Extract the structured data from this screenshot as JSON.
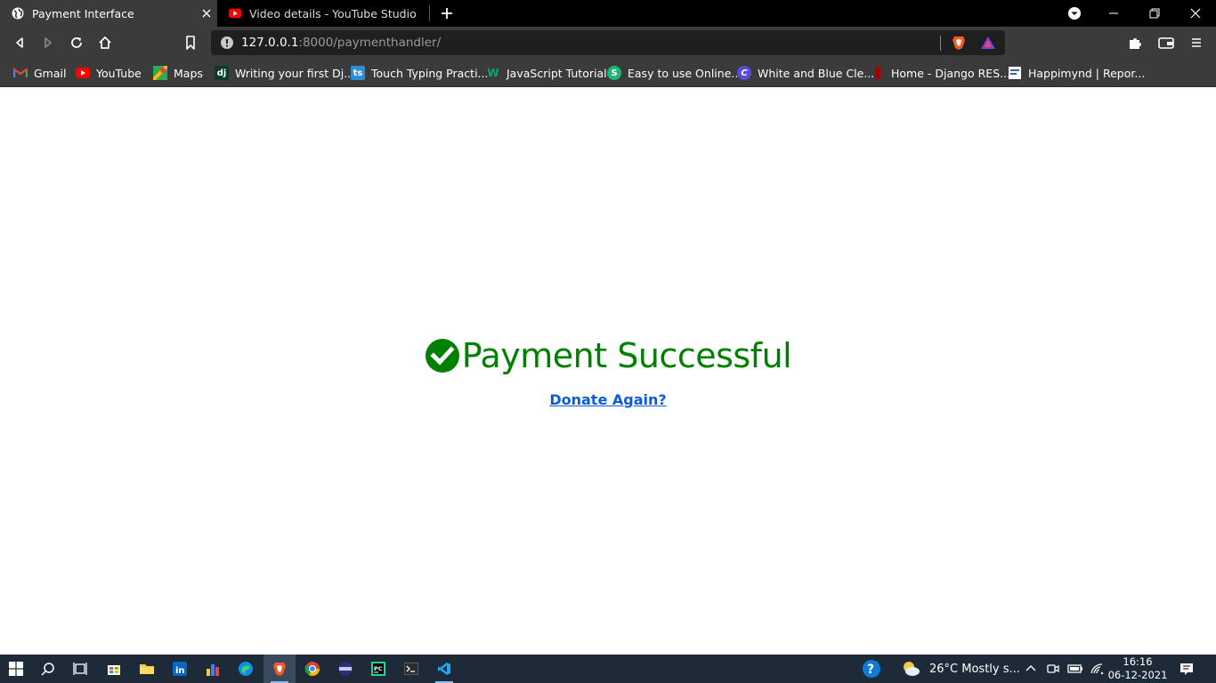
{
  "tabs": [
    {
      "title": "Payment Interface",
      "active": true
    },
    {
      "title": "Video details - YouTube Studio",
      "active": false
    }
  ],
  "address_bar": {
    "host": "127.0.0.1",
    "rest": ":8000/paymenthandler/"
  },
  "bookmarks": [
    {
      "label": "Gmail",
      "icon": "gmail-icon"
    },
    {
      "label": "YouTube",
      "icon": "youtube-icon"
    },
    {
      "label": "Maps",
      "icon": "maps-icon"
    },
    {
      "label": "Writing your first Dj...",
      "icon": "django-icon"
    },
    {
      "label": "Touch Typing Practi...",
      "icon": "typing-icon"
    },
    {
      "label": "JavaScript Tutorial",
      "icon": "w3schools-icon"
    },
    {
      "label": "Easy to use Online...",
      "icon": "s-icon"
    },
    {
      "label": "White and Blue Cle...",
      "icon": "canva-icon"
    },
    {
      "label": "Home - Django RES...",
      "icon": "drf-icon"
    },
    {
      "label": "Happimynd | Repor...",
      "icon": "report-icon"
    }
  ],
  "page": {
    "heading": "Payment Successful",
    "link": "Donate Again?"
  },
  "taskbar": {
    "weather": "26°C  Mostly s...",
    "time": "16:16",
    "date": "06-12-2021"
  },
  "colors": {
    "success_green": "#008000",
    "link_blue": "#0b5cd6",
    "chrome_dark": "#3b3b3b",
    "taskbar_bg": "#1d2a38"
  }
}
